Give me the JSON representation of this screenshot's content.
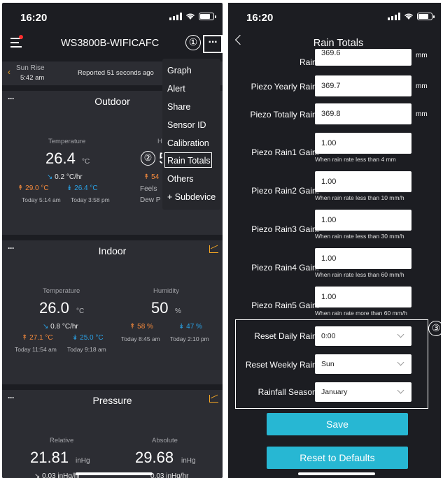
{
  "left": {
    "status_time": "16:20",
    "device_title": "WS3800B-WIFICAFC",
    "annotation_1": "①",
    "more_label": "···",
    "sunrise": {
      "label": "Sun Rise",
      "time": "5:42 am"
    },
    "reported": "Reported 51 seconds ago",
    "outdoor": {
      "title": "Outdoor",
      "temp_label": "Temperature",
      "temp_value": "26.4",
      "temp_unit": "°C",
      "rate_arrow": "↘",
      "rate_value": "0.2",
      "rate_unit": "°C/hr",
      "high": "↟ 29.0 °C",
      "low": "↡ 26.4 °C",
      "high_time": "Today 5:14 am",
      "low_time": "Today 3:58 pm",
      "partial_hum_label": "H",
      "partial_hum_value": "5",
      "partial_high": "↟ 54",
      "partial_feels": "Feels",
      "partial_dew": "Dew P"
    },
    "menu": {
      "items": [
        "Graph",
        "Alert",
        "Share",
        "Sensor ID",
        "Calibration",
        "Rain Totals",
        "Others",
        "+ Subdevice"
      ],
      "annotation_2": "②"
    },
    "indoor": {
      "title": "Indoor",
      "temp_label": "Temperature",
      "temp_value": "26.0",
      "temp_unit": "°C",
      "rate_arrow": "↘",
      "rate_value": "0.8",
      "rate_unit": "°C/hr",
      "high": "↟ 27.1 °C",
      "low": "↡ 25.0 °C",
      "high_time": "Today 11:54 am",
      "low_time": "Today 9:18 am",
      "hum_label": "Humidity",
      "hum_value": "50",
      "hum_unit": "%",
      "hum_high": "↟ 58 %",
      "hum_low": "↡ 47 %",
      "hum_high_time": "Today 8:45 am",
      "hum_low_time": "Today 2:10 pm"
    },
    "pressure": {
      "title": "Pressure",
      "rel_label": "Relative",
      "rel_value": "21.81",
      "rel_unit": "inHg",
      "abs_label": "Absolute",
      "abs_value": "29.68",
      "abs_unit": "inHg",
      "rel_rate": "↘ 0.03 inHg/hr",
      "abs_rate": "0.03 inHg/hr"
    }
  },
  "right": {
    "status_time": "16:20",
    "title": "Rain Totals",
    "partial_label": "Rain:",
    "partial_value": "369.6",
    "partial_unit": "mm",
    "yearly": {
      "label": "Piezo Yearly Rain:",
      "value": "369.7",
      "unit": "mm"
    },
    "totally": {
      "label": "Piezo Totally Rain:",
      "value": "369.8",
      "unit": "mm"
    },
    "gains": [
      {
        "label": "Piezo Rain1 Gain:",
        "value": "1.00",
        "hint": "When rain rate less than 4 mm"
      },
      {
        "label": "Piezo Rain2 Gain:",
        "value": "1.00",
        "hint": "When rain rate less than 10 mm/h"
      },
      {
        "label": "Piezo Rain3 Gain:",
        "value": "1.00",
        "hint": "When rain rate less than 30 mm/h"
      },
      {
        "label": "Piezo Rain4 Gain:",
        "value": "1.00",
        "hint": "When rain rate less than 60 mm/h"
      },
      {
        "label": "Piezo Rain5 Gain:",
        "value": "1.00",
        "hint": "When rain rate more than 60 mm/h"
      }
    ],
    "reset_daily": {
      "label": "Reset Daily Rain:",
      "value": "0:00"
    },
    "reset_weekly": {
      "label": "Reset Weekly Rain:",
      "value": "Sun"
    },
    "rainfall_season": {
      "label": "Rainfall Season:",
      "value": "January"
    },
    "annotation_3": "③",
    "save_label": "Save",
    "reset_defaults_label": "Reset to Defaults"
  },
  "colors": {
    "accent": "#27b7d3",
    "orange": "#f58a3c",
    "blue": "#2aa3e8",
    "background": "#1c1d22",
    "panel": "#2c2d33"
  }
}
